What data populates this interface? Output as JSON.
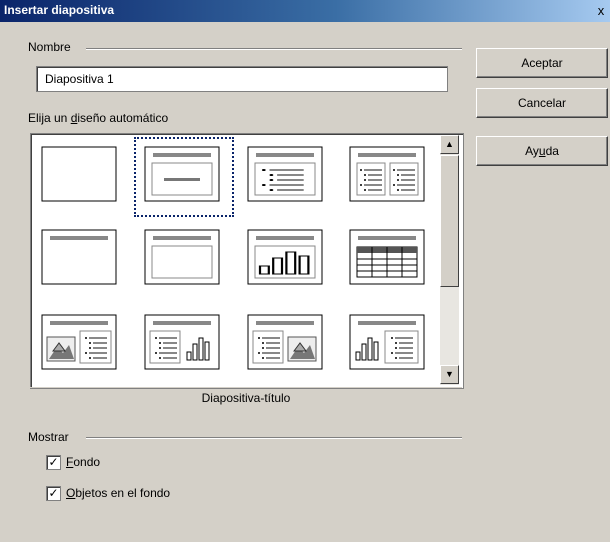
{
  "window": {
    "title": "Insertar diapositiva",
    "close_label": "x"
  },
  "nombre": {
    "group_label": "Nombre",
    "value": "Diapositiva 1"
  },
  "layout": {
    "label_before": "Elija un ",
    "label_accel": "d",
    "label_after": "iseño automático",
    "selected_name": "Diapositiva-título",
    "selected_index": 1,
    "tiles": [
      "layout-blank",
      "layout-title-only",
      "layout-title-text",
      "layout-title-two-text",
      "layout-title-only-bar",
      "layout-title-placeholder",
      "layout-title-chart",
      "layout-title-table",
      "layout-image-text",
      "layout-text-chart",
      "layout-text-image",
      "layout-chart-text"
    ]
  },
  "buttons": {
    "ok": "Aceptar",
    "cancel": "Cancelar",
    "help_before": "Ay",
    "help_accel": "u",
    "help_after": "da"
  },
  "mostrar": {
    "group_label": "Mostrar",
    "fondo_accel": "F",
    "fondo_rest": "ondo",
    "fondo_checked": true,
    "objetos_accel": "O",
    "objetos_rest": "bjetos en el fondo",
    "objetos_checked": true
  },
  "colors": {
    "title_start": "#0a246a",
    "title_end": "#a6caf0",
    "face": "#d4d0c8"
  }
}
